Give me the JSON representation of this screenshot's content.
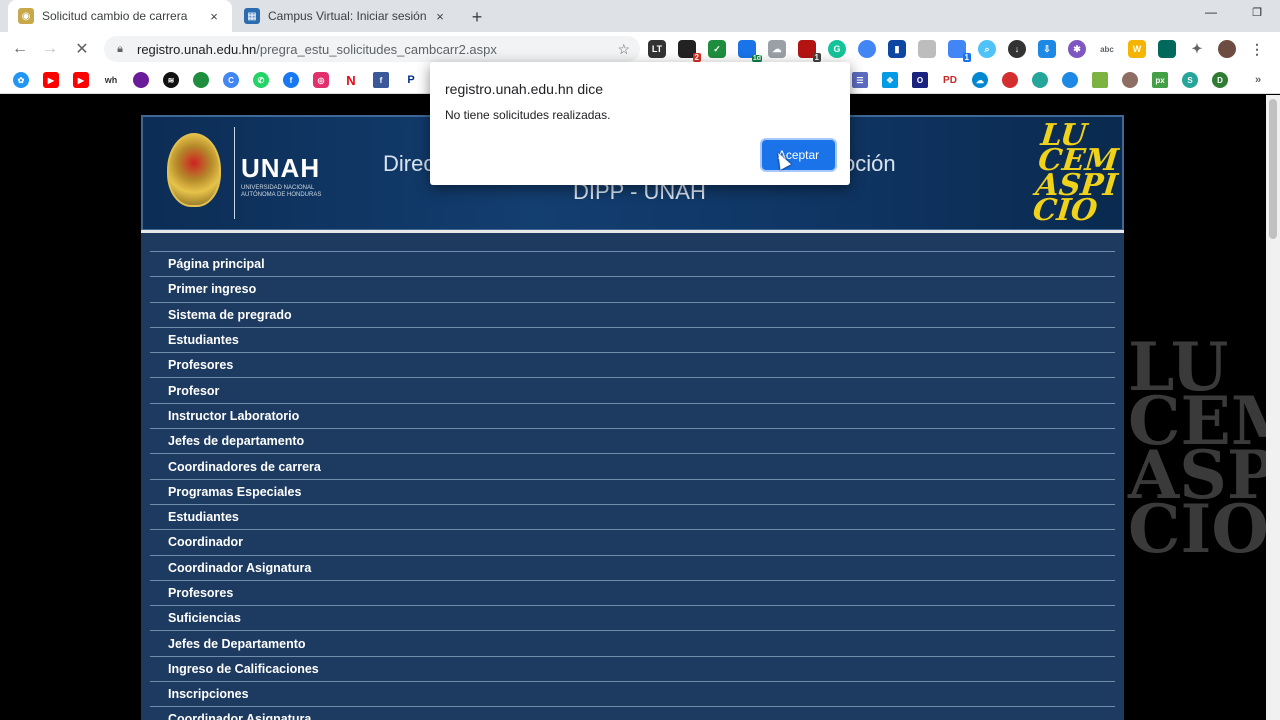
{
  "tabs": [
    {
      "title": "Solicitud cambio de carrera",
      "active": true,
      "close": "×"
    },
    {
      "title": "Campus Virtual: Iniciar sesión en el sitio",
      "active": false,
      "close": "×"
    }
  ],
  "new_tab": "+",
  "window_controls": {
    "minimize": "—",
    "restore": "❐",
    "close": "✕"
  },
  "nav": {
    "back": "←",
    "forward": "→",
    "reload": "✕"
  },
  "address": {
    "host": "registro.unah.edu.hn",
    "path": "/pregra_estu_solicitudes_cambcarr2.aspx"
  },
  "extension_badges": {
    "red": "2",
    "blue": "1d",
    "tool": "1",
    "gear": "1"
  },
  "bookmarks_labels": {
    "wh": "wh"
  },
  "banner": {
    "logo_text": "UNAH",
    "logo_subtext": "UNIVERSIDAD NACIONAL AUTÓNOMA DE HONDURAS",
    "title_line1_start": "Direc",
    "title_line1_end": "oción",
    "title_line2": "DIPP - UNAH",
    "motto": [
      "LU",
      "CEM",
      "ASPI",
      "CIO"
    ]
  },
  "watermark": [
    "LU",
    "CEM",
    "ASPI",
    "CIO"
  ],
  "menu": [
    "Página principal",
    "Primer ingreso",
    "Sistema de pregrado",
    "Estudiantes",
    "Profesores",
    "Profesor",
    "Instructor Laboratorio",
    "Jefes de departamento",
    "Coordinadores de carrera",
    "Programas Especiales",
    "Estudiantes",
    "Coordinador",
    "Coordinador Asignatura",
    "Profesores",
    "Suficiencias",
    "Jefes de Departamento",
    "Ingreso de Calificaciones",
    "Inscripciones",
    "Coordinador Asignatura"
  ],
  "dialog": {
    "title": "registro.unah.edu.hn dice",
    "message": "No tiene solicitudes realizadas.",
    "button": "Aceptar"
  },
  "colors": {
    "accent": "#1a73e8",
    "menu_bg": "#1d3b61",
    "banner": "#133e70",
    "motto": "#f0d21a"
  }
}
